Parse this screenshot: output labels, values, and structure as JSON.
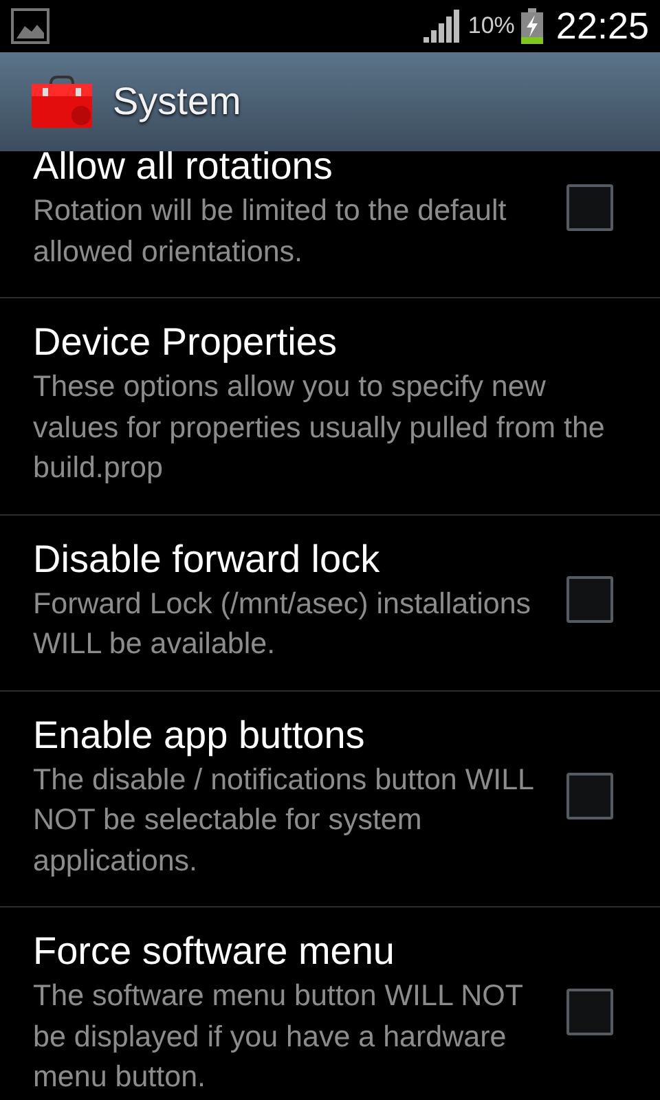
{
  "status_bar": {
    "battery": "10%",
    "time": "22:25"
  },
  "action_bar": {
    "title": "System"
  },
  "items": [
    {
      "kind": "checkbox",
      "title": "Allow all rotations",
      "summary": "Rotation will be limited to the default allowed orientations.",
      "checked": false
    },
    {
      "kind": "screen",
      "title": "Device Properties",
      "summary": "These options allow you to specify new values for properties usually pulled from the build.prop"
    },
    {
      "kind": "checkbox",
      "title": "Disable forward lock",
      "summary": "Forward Lock (/mnt/asec) installations WILL be available.",
      "checked": false
    },
    {
      "kind": "checkbox",
      "title": "Enable app buttons",
      "summary": "The disable / notifications button WILL NOT be selectable for system applications.",
      "checked": false
    },
    {
      "kind": "checkbox",
      "title": "Force software menu",
      "summary": "The software menu button WILL NOT be displayed if you have a hardware menu button.",
      "checked": false
    }
  ]
}
